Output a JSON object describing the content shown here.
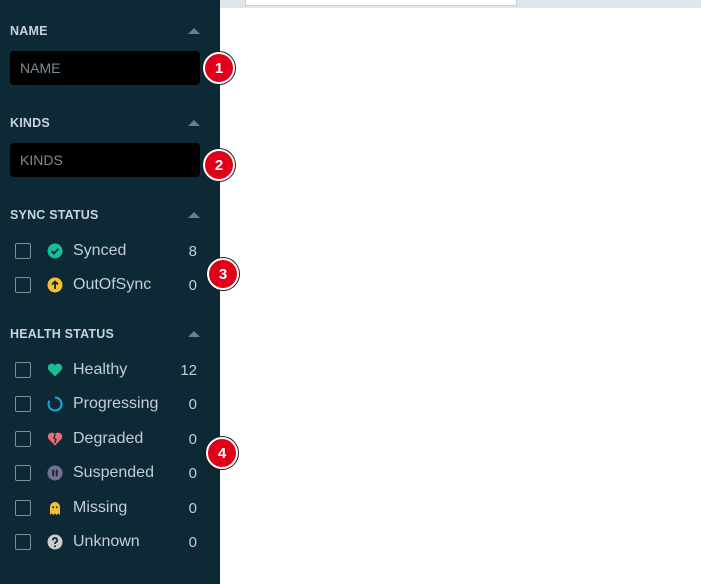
{
  "filters": {
    "name": {
      "title": "NAME",
      "placeholder": "NAME"
    },
    "kinds": {
      "title": "KINDS",
      "placeholder": "KINDS"
    },
    "sync_status": {
      "title": "SYNC STATUS",
      "items": [
        {
          "label": "Synced",
          "count": "8",
          "icon": "check-circle-icon",
          "color": "#18be94"
        },
        {
          "label": "OutOfSync",
          "count": "0",
          "icon": "arrow-up-circle-icon",
          "color": "#f4c030"
        }
      ]
    },
    "health_status": {
      "title": "HEALTH STATUS",
      "items": [
        {
          "label": "Healthy",
          "count": "12",
          "icon": "heart-icon",
          "color": "#18be94"
        },
        {
          "label": "Progressing",
          "count": "0",
          "icon": "progress-ring-icon",
          "color": "#0dadea"
        },
        {
          "label": "Degraded",
          "count": "0",
          "icon": "broken-heart-icon",
          "color": "#e96d76"
        },
        {
          "label": "Suspended",
          "count": "0",
          "icon": "pause-circle-icon",
          "color": "#766f94"
        },
        {
          "label": "Missing",
          "count": "0",
          "icon": "ghost-icon",
          "color": "#f4c030"
        },
        {
          "label": "Unknown",
          "count": "0",
          "icon": "question-circle-icon",
          "color": "#cccccc"
        }
      ]
    }
  },
  "annotations": {
    "badge_1": "1",
    "badge_2": "2",
    "badge_3": "3",
    "badge_4": "4"
  }
}
